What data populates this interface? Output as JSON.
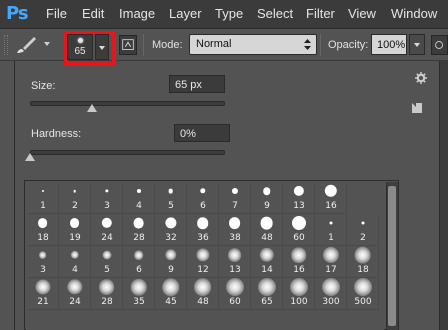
{
  "menubar": {
    "logo": "Ps",
    "items": [
      "File",
      "Edit",
      "Image",
      "Layer",
      "Type",
      "Select",
      "Filter",
      "View",
      "Window"
    ]
  },
  "options_bar": {
    "brush_preset_size": "65",
    "mode_label": "Mode:",
    "mode_value": "Normal",
    "opacity_label": "Opacity:",
    "opacity_value": "100%"
  },
  "brush_panel": {
    "size_label": "Size:",
    "size_value": "65 px",
    "size_fraction": 0.3,
    "hardness_label": "Hardness:",
    "hardness_value": "0%",
    "hardness_fraction": 0.0
  },
  "brushes": [
    [
      "1",
      "2",
      "3",
      "4",
      "5",
      "6",
      "7",
      "9",
      "13",
      "16"
    ],
    [
      "18",
      "19",
      "24",
      "28",
      "32",
      "36",
      "38",
      "48",
      "60",
      "1",
      "2"
    ],
    [
      "3",
      "4",
      "5",
      "6",
      "9",
      "12",
      "13",
      "14",
      "16",
      "17",
      "18"
    ],
    [
      "21",
      "24",
      "28",
      "35",
      "45",
      "48",
      "60",
      "65",
      "100",
      "300",
      "500"
    ]
  ],
  "colors": {
    "highlight_box": "#e8161c",
    "ps_logo": "#43a7ff"
  }
}
